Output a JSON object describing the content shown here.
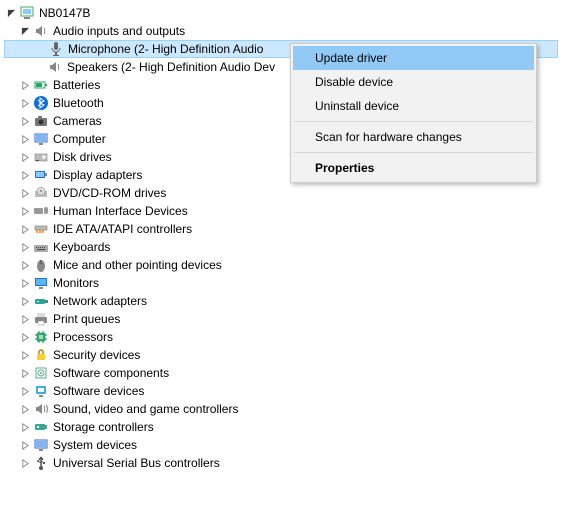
{
  "root": {
    "label": "NB0147B"
  },
  "audio": {
    "label": "Audio inputs and outputs",
    "mic": "Microphone (2- High Definition Audio",
    "speakers": "Speakers (2- High Definition Audio Dev"
  },
  "categories": {
    "batteries": "Batteries",
    "bluetooth": "Bluetooth",
    "cameras": "Cameras",
    "computer": "Computer",
    "disk": "Disk drives",
    "display": "Display adapters",
    "dvd": "DVD/CD-ROM drives",
    "hid": "Human Interface Devices",
    "ide": "IDE ATA/ATAPI controllers",
    "keyboards": "Keyboards",
    "mice": "Mice and other pointing devices",
    "monitors": "Monitors",
    "network": "Network adapters",
    "print": "Print queues",
    "processors": "Processors",
    "security": "Security devices",
    "swcomp": "Software components",
    "swdev": "Software devices",
    "sound": "Sound, video and game controllers",
    "storage": "Storage controllers",
    "system": "System devices",
    "usb": "Universal Serial Bus controllers"
  },
  "menu": {
    "update": "Update driver",
    "disable": "Disable device",
    "uninstall": "Uninstall device",
    "scan": "Scan for hardware changes",
    "properties": "Properties"
  }
}
